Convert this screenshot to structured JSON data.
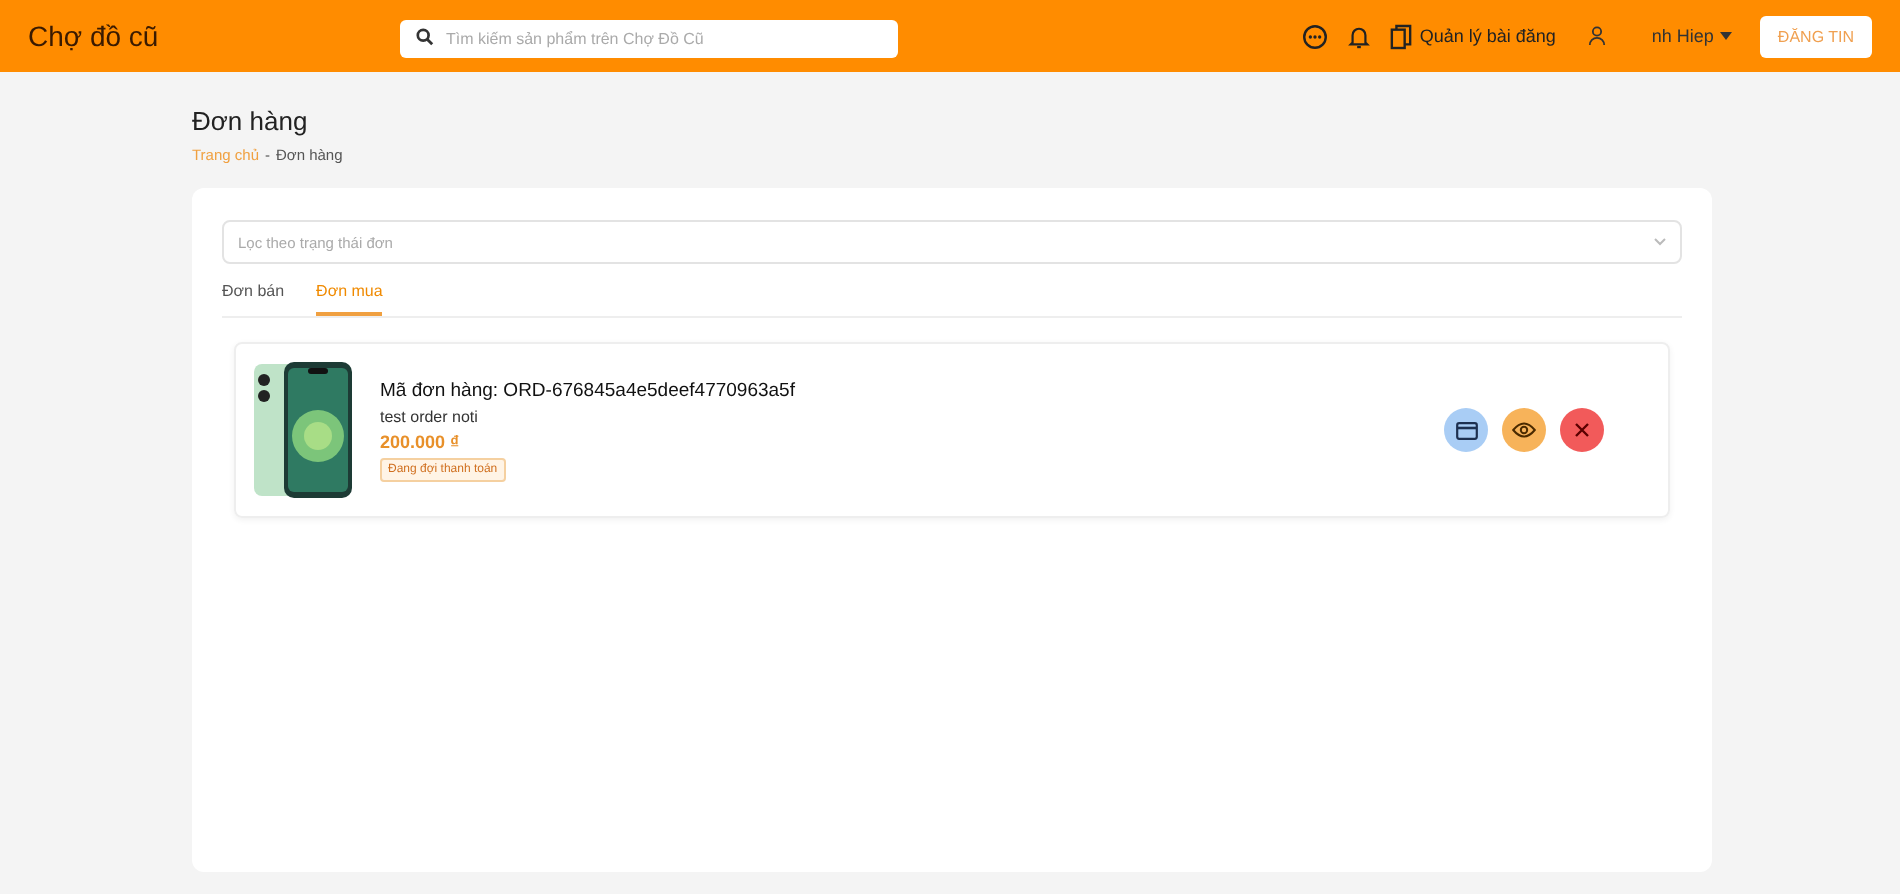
{
  "header": {
    "logo": "Chợ đồ cũ",
    "search": {
      "placeholder": "Tìm kiếm sản phẩm trên Chợ Đồ Cũ"
    },
    "manage_link": "Quản lý bài đăng",
    "user_name": "nh Hiep",
    "post_button": "ĐĂNG TIN"
  },
  "page": {
    "title": "Đơn hàng",
    "breadcrumb_separator": "-",
    "breadcrumb": [
      {
        "label": "Trang chủ",
        "link": true
      },
      {
        "label": "Đơn hàng",
        "link": false
      }
    ]
  },
  "filter": {
    "placeholder": "Lọc theo trạng thái đơn"
  },
  "tabs": [
    {
      "label": "Đơn bán",
      "selected": false
    },
    {
      "label": "Đơn mua",
      "selected": true
    }
  ],
  "orders": [
    {
      "code": "Mã đơn hàng: ORD-676845a4e5deef4770963a5f",
      "title": "test order noti",
      "price": "200.000 ₫",
      "status": "Đang đợi thanh toán",
      "actions": [
        {
          "kind": "pay"
        },
        {
          "kind": "view"
        },
        {
          "kind": "cancel"
        }
      ]
    }
  ]
}
